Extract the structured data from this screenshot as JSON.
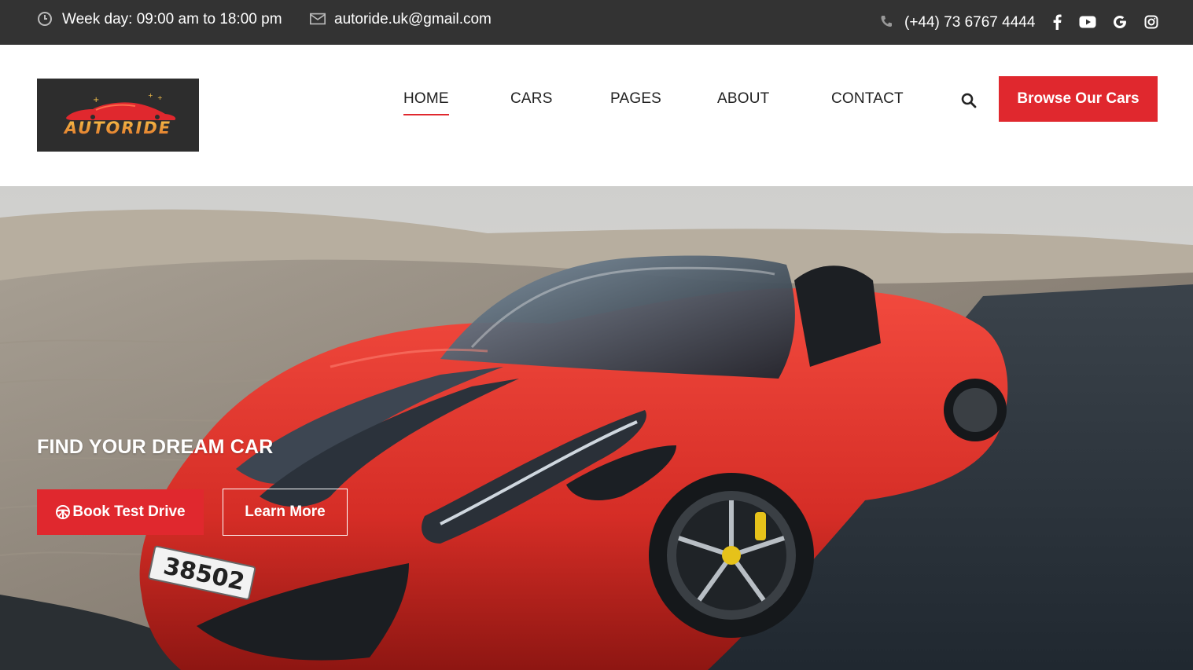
{
  "topbar": {
    "hours": "Week day: 09:00 am to 18:00 pm",
    "email": "autoride.uk@gmail.com",
    "phone": "(+44) 73 6767 4444",
    "social": [
      "facebook-icon",
      "youtube-icon",
      "google-icon",
      "instagram-icon"
    ]
  },
  "header": {
    "logo_text": "AUTORIDE",
    "nav": [
      {
        "label": "HOME",
        "active": true
      },
      {
        "label": "CARS",
        "active": false
      },
      {
        "label": "PAGES",
        "active": false
      },
      {
        "label": "ABOUT",
        "active": false
      },
      {
        "label": "CONTACT",
        "active": false
      }
    ],
    "search_icon": "search-icon",
    "cta_label": "Browse Our Cars"
  },
  "hero": {
    "title": "FIND YOUR DREAM CAR",
    "primary_label": "Book Test Drive",
    "secondary_label": "Learn More",
    "plate_text": "38502"
  },
  "colors": {
    "accent": "#e0282e",
    "topbar_bg": "#333333",
    "logo_bg": "#2d2d2d"
  }
}
